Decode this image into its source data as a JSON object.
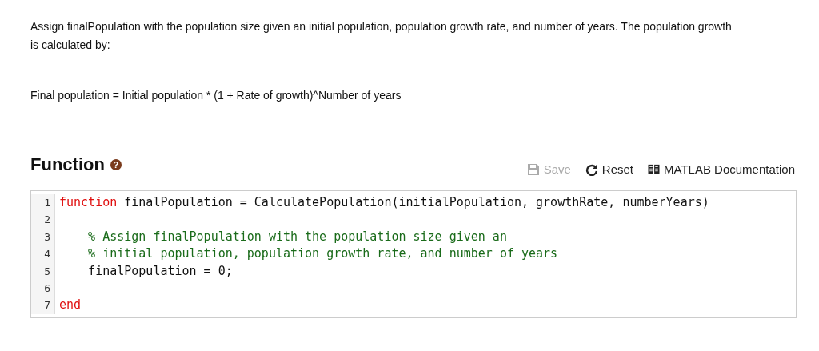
{
  "description": "Assign finalPopulation with the population size given an initial population, population growth rate, and number of years. The population growth is calculated by:",
  "formula": "Final population = Initial population * (1 + Rate of growth)^Number of years",
  "section": {
    "title": "Function",
    "help_icon": "?"
  },
  "toolbar": [
    {
      "kind": "save",
      "label": "Save",
      "disabled": true
    },
    {
      "kind": "reset",
      "label": "Reset",
      "disabled": false
    },
    {
      "kind": "docs",
      "label": "MATLAB Documentation",
      "disabled": false
    }
  ],
  "code": [
    {
      "number": "1",
      "tokens": [
        {
          "kind": "keyword",
          "text": "function"
        },
        {
          "kind": "plain",
          "text": " finalPopulation = CalculatePopulation(initialPopulation, growthRate, numberYears)"
        }
      ]
    },
    {
      "number": "2"
    },
    {
      "number": "3",
      "tokens": [
        {
          "kind": "comment",
          "text": "    % Assign finalPopulation with the population size given an"
        }
      ]
    },
    {
      "number": "4",
      "tokens": [
        {
          "kind": "comment",
          "text": "    % initial population, population growth rate, and number of years"
        }
      ]
    },
    {
      "number": "5",
      "tokens": [
        {
          "kind": "plain",
          "text": "    finalPopulation = 0;"
        }
      ]
    },
    {
      "number": "6"
    },
    {
      "number": "7",
      "tokens": [
        {
          "kind": "keyword",
          "text": "end"
        }
      ]
    }
  ]
}
